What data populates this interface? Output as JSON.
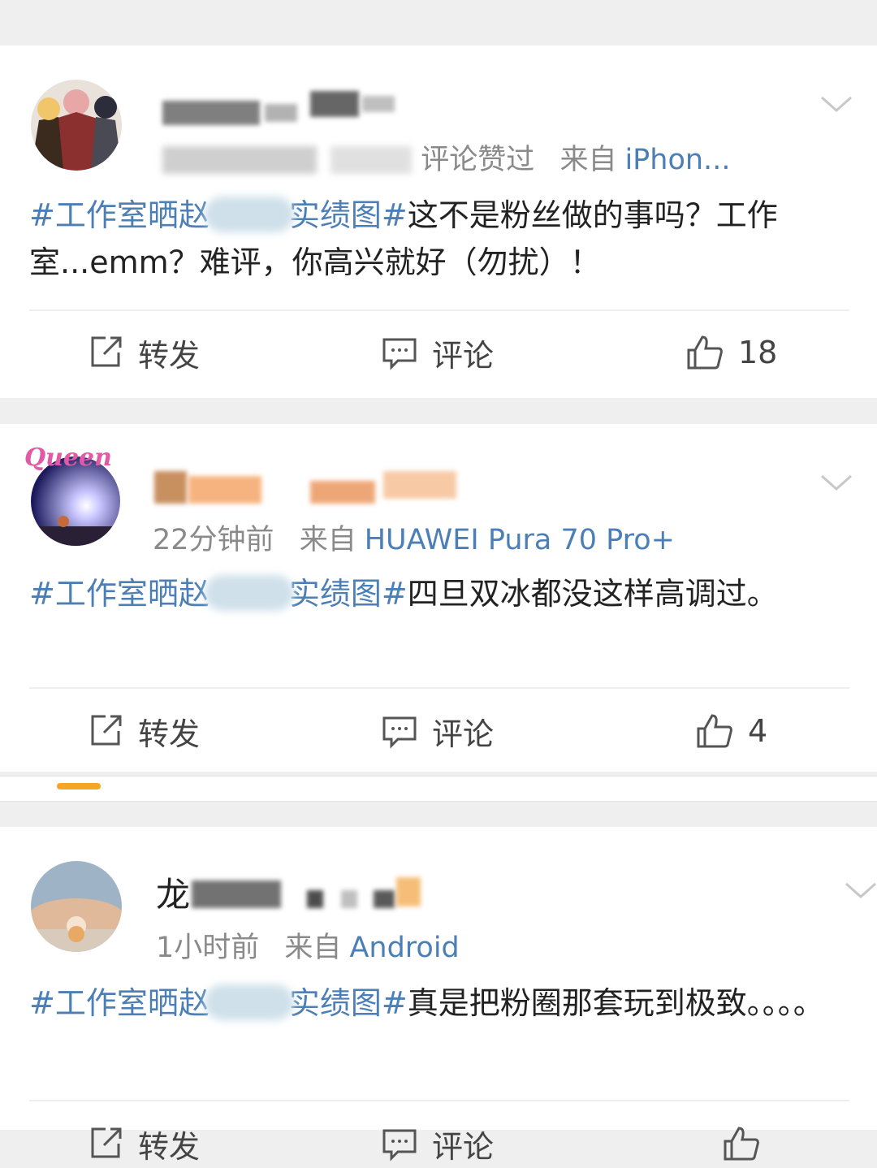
{
  "posts": [
    {
      "meta_time": "",
      "meta_prefix": "",
      "meta_tail": "评论赞过",
      "meta_from": "来自",
      "meta_source": "iPhon...",
      "hashtag_start": "#工作室晒赵",
      "hashtag_end": "实绩图#",
      "text": "这不是粉丝做的事吗？工作室...emm？难评，你高兴就好（勿扰）！",
      "repost_label": "转发",
      "comment_label": "评论",
      "like_count": "18"
    },
    {
      "meta_time": "22分钟前",
      "meta_from": "来自",
      "meta_source": "HUAWEI Pura 70 Pro+",
      "hashtag_start": "#工作室晒赵",
      "hashtag_end": "实绩图#",
      "text": "四旦双冰都没这样高调过。",
      "repost_label": "转发",
      "comment_label": "评论",
      "like_count": "4"
    },
    {
      "name_prefix": "龙",
      "meta_time": "1小时前",
      "meta_from": "来自",
      "meta_source": "Android",
      "hashtag_start": "#工作室晒赵",
      "hashtag_end": "实绩图#",
      "text": "真是把粉圈那套玩到极致。。。。",
      "repost_label": "转发",
      "comment_label": "评论"
    }
  ],
  "colors": {
    "link": "#4b7fb5",
    "meta": "#8a8a8a",
    "tab_indicator": "#f5a623",
    "background": "#efefef"
  },
  "icons": [
    "repost-icon",
    "comment-icon",
    "like-icon",
    "chevron-down-icon"
  ]
}
